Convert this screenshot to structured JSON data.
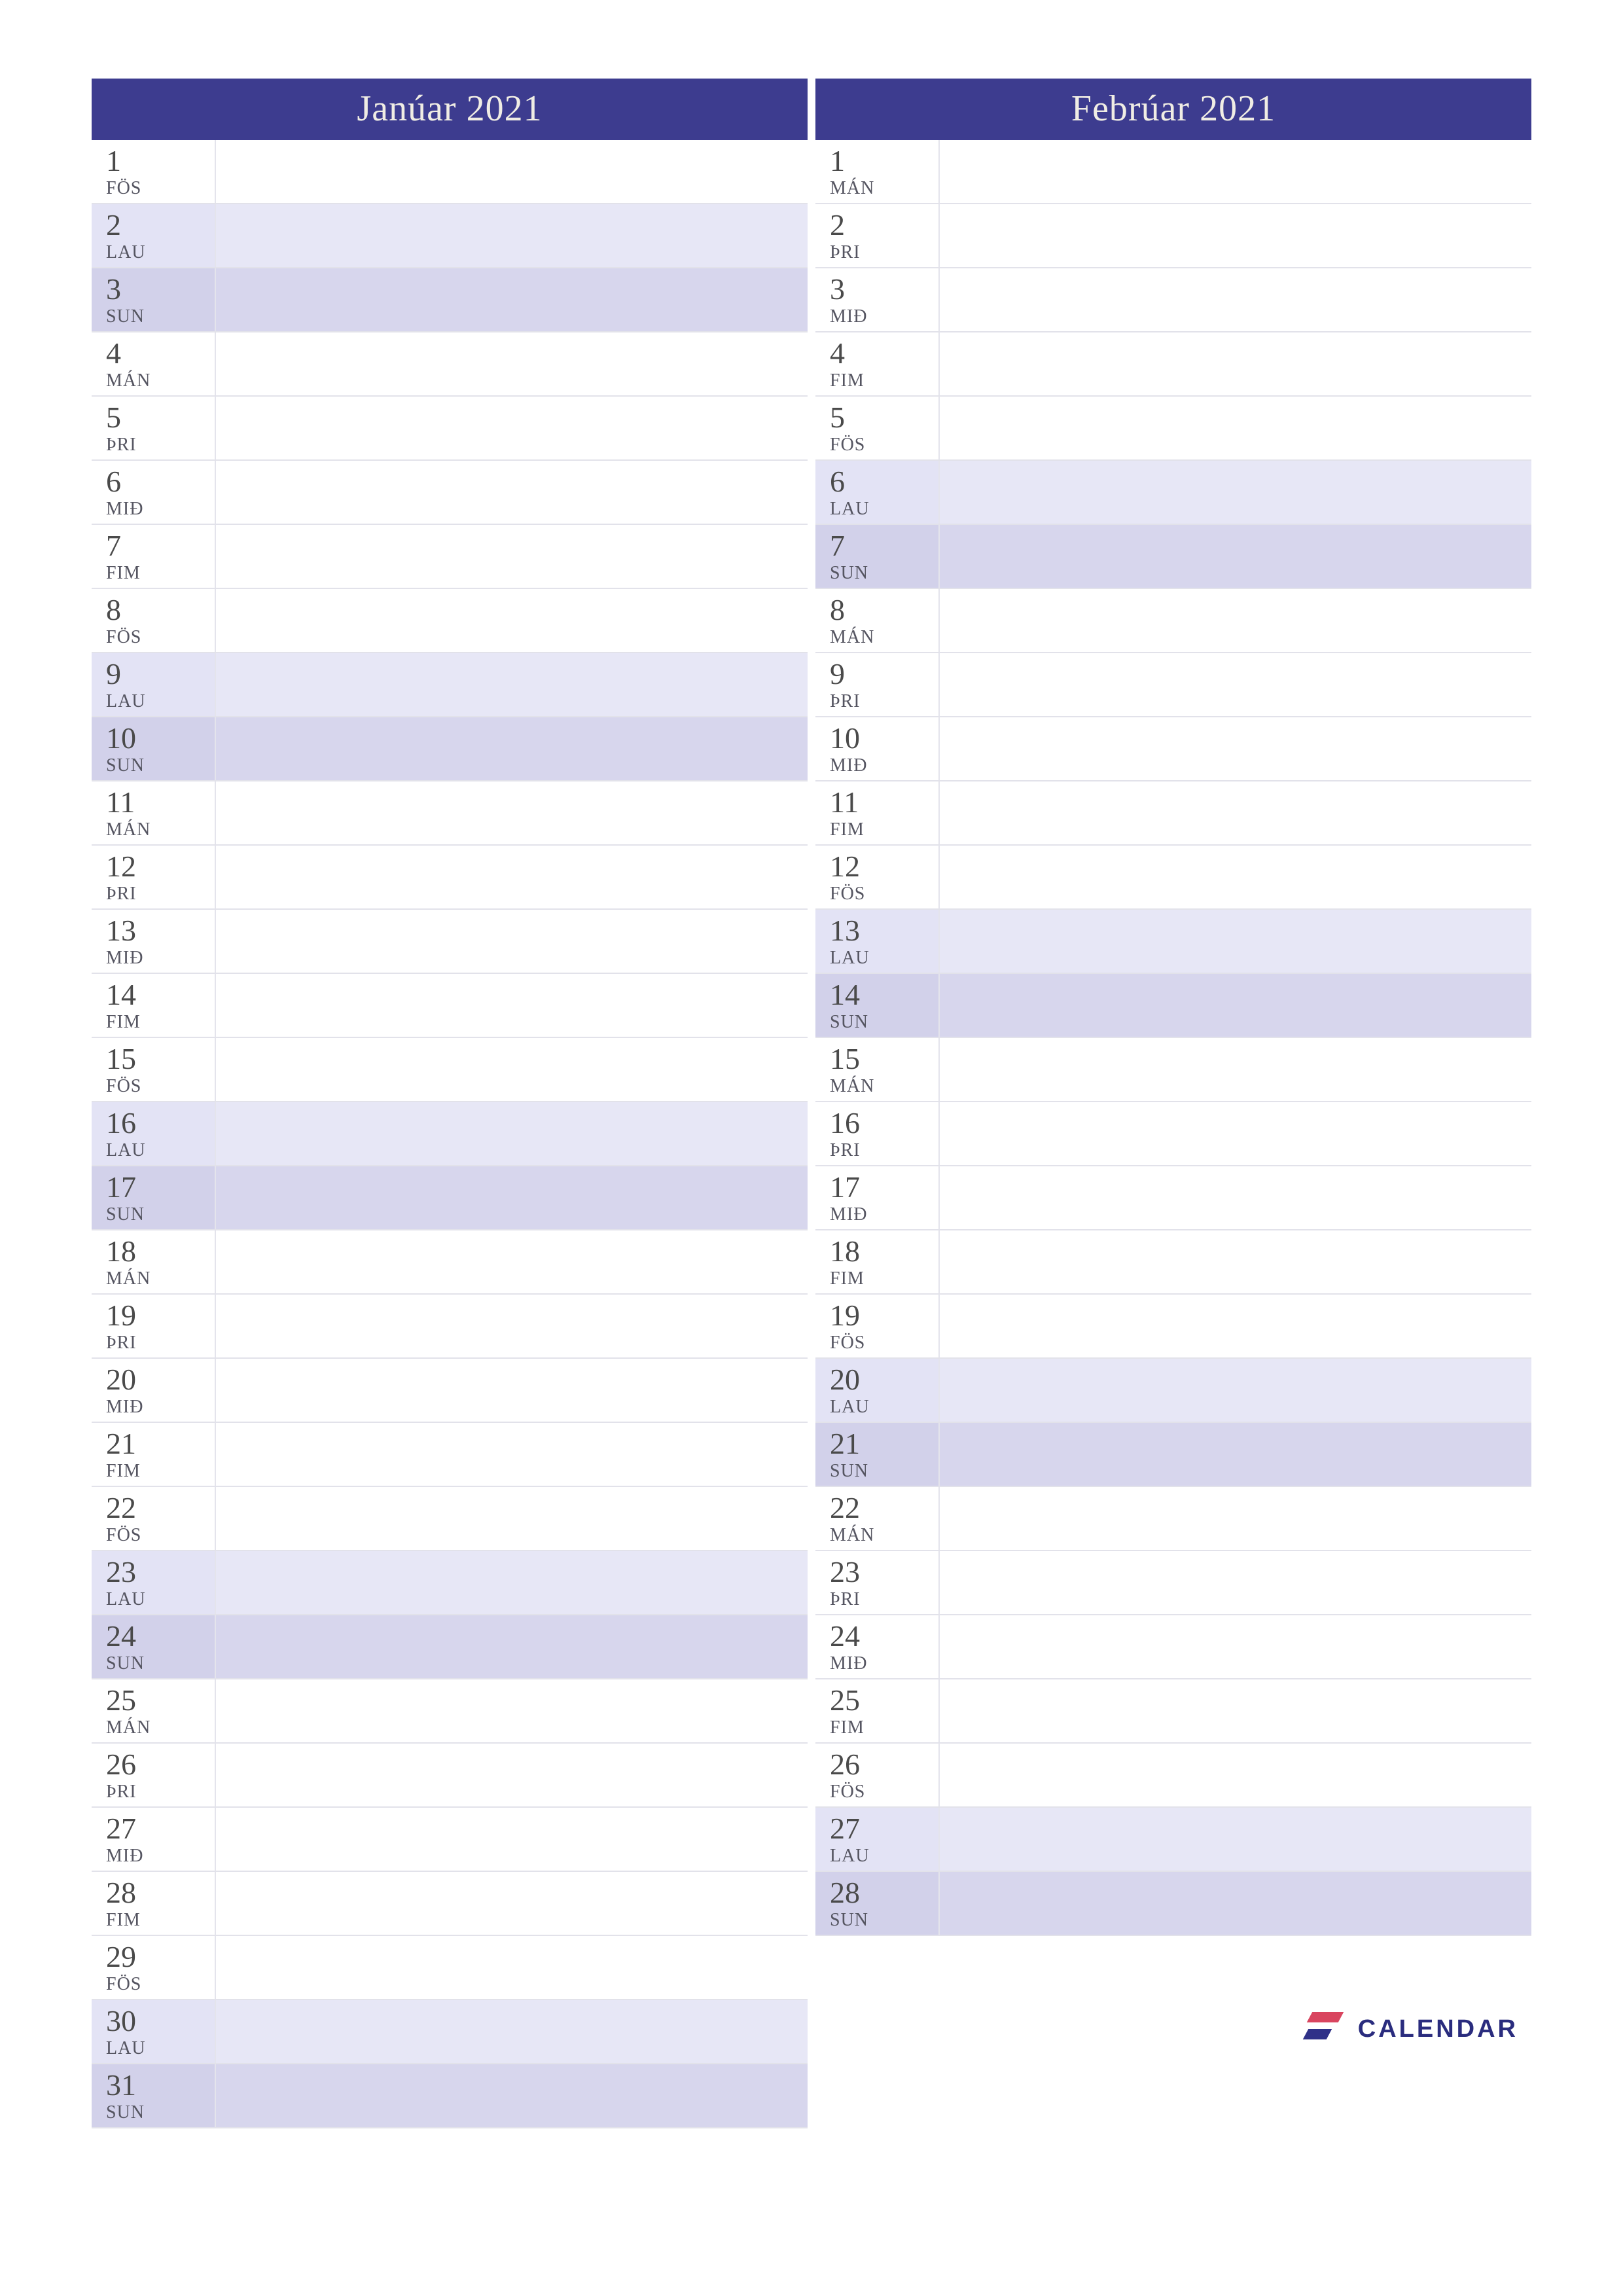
{
  "colors": {
    "header_bg": "#3d3c8f",
    "header_fg": "#f0ede4",
    "sat_bg": "#e3e3f5",
    "sun_bg": "#d2d1ea"
  },
  "logo_text": "CALENDAR",
  "months": [
    {
      "title": "Janúar 2021",
      "days": [
        {
          "num": "1",
          "name": "FÖS",
          "kind": "weekday"
        },
        {
          "num": "2",
          "name": "LAU",
          "kind": "sat"
        },
        {
          "num": "3",
          "name": "SUN",
          "kind": "sun"
        },
        {
          "num": "4",
          "name": "MÁN",
          "kind": "weekday"
        },
        {
          "num": "5",
          "name": "ÞRI",
          "kind": "weekday"
        },
        {
          "num": "6",
          "name": "MIÐ",
          "kind": "weekday"
        },
        {
          "num": "7",
          "name": "FIM",
          "kind": "weekday"
        },
        {
          "num": "8",
          "name": "FÖS",
          "kind": "weekday"
        },
        {
          "num": "9",
          "name": "LAU",
          "kind": "sat"
        },
        {
          "num": "10",
          "name": "SUN",
          "kind": "sun"
        },
        {
          "num": "11",
          "name": "MÁN",
          "kind": "weekday"
        },
        {
          "num": "12",
          "name": "ÞRI",
          "kind": "weekday"
        },
        {
          "num": "13",
          "name": "MIÐ",
          "kind": "weekday"
        },
        {
          "num": "14",
          "name": "FIM",
          "kind": "weekday"
        },
        {
          "num": "15",
          "name": "FÖS",
          "kind": "weekday"
        },
        {
          "num": "16",
          "name": "LAU",
          "kind": "sat"
        },
        {
          "num": "17",
          "name": "SUN",
          "kind": "sun"
        },
        {
          "num": "18",
          "name": "MÁN",
          "kind": "weekday"
        },
        {
          "num": "19",
          "name": "ÞRI",
          "kind": "weekday"
        },
        {
          "num": "20",
          "name": "MIÐ",
          "kind": "weekday"
        },
        {
          "num": "21",
          "name": "FIM",
          "kind": "weekday"
        },
        {
          "num": "22",
          "name": "FÖS",
          "kind": "weekday"
        },
        {
          "num": "23",
          "name": "LAU",
          "kind": "sat"
        },
        {
          "num": "24",
          "name": "SUN",
          "kind": "sun"
        },
        {
          "num": "25",
          "name": "MÁN",
          "kind": "weekday"
        },
        {
          "num": "26",
          "name": "ÞRI",
          "kind": "weekday"
        },
        {
          "num": "27",
          "name": "MIÐ",
          "kind": "weekday"
        },
        {
          "num": "28",
          "name": "FIM",
          "kind": "weekday"
        },
        {
          "num": "29",
          "name": "FÖS",
          "kind": "weekday"
        },
        {
          "num": "30",
          "name": "LAU",
          "kind": "sat"
        },
        {
          "num": "31",
          "name": "SUN",
          "kind": "sun"
        }
      ]
    },
    {
      "title": "Febrúar 2021",
      "days": [
        {
          "num": "1",
          "name": "MÁN",
          "kind": "weekday"
        },
        {
          "num": "2",
          "name": "ÞRI",
          "kind": "weekday"
        },
        {
          "num": "3",
          "name": "MIÐ",
          "kind": "weekday"
        },
        {
          "num": "4",
          "name": "FIM",
          "kind": "weekday"
        },
        {
          "num": "5",
          "name": "FÖS",
          "kind": "weekday"
        },
        {
          "num": "6",
          "name": "LAU",
          "kind": "sat"
        },
        {
          "num": "7",
          "name": "SUN",
          "kind": "sun"
        },
        {
          "num": "8",
          "name": "MÁN",
          "kind": "weekday"
        },
        {
          "num": "9",
          "name": "ÞRI",
          "kind": "weekday"
        },
        {
          "num": "10",
          "name": "MIÐ",
          "kind": "weekday"
        },
        {
          "num": "11",
          "name": "FIM",
          "kind": "weekday"
        },
        {
          "num": "12",
          "name": "FÖS",
          "kind": "weekday"
        },
        {
          "num": "13",
          "name": "LAU",
          "kind": "sat"
        },
        {
          "num": "14",
          "name": "SUN",
          "kind": "sun"
        },
        {
          "num": "15",
          "name": "MÁN",
          "kind": "weekday"
        },
        {
          "num": "16",
          "name": "ÞRI",
          "kind": "weekday"
        },
        {
          "num": "17",
          "name": "MIÐ",
          "kind": "weekday"
        },
        {
          "num": "18",
          "name": "FIM",
          "kind": "weekday"
        },
        {
          "num": "19",
          "name": "FÖS",
          "kind": "weekday"
        },
        {
          "num": "20",
          "name": "LAU",
          "kind": "sat"
        },
        {
          "num": "21",
          "name": "SUN",
          "kind": "sun"
        },
        {
          "num": "22",
          "name": "MÁN",
          "kind": "weekday"
        },
        {
          "num": "23",
          "name": "ÞRI",
          "kind": "weekday"
        },
        {
          "num": "24",
          "name": "MIÐ",
          "kind": "weekday"
        },
        {
          "num": "25",
          "name": "FIM",
          "kind": "weekday"
        },
        {
          "num": "26",
          "name": "FÖS",
          "kind": "weekday"
        },
        {
          "num": "27",
          "name": "LAU",
          "kind": "sat"
        },
        {
          "num": "28",
          "name": "SUN",
          "kind": "sun"
        }
      ]
    }
  ]
}
